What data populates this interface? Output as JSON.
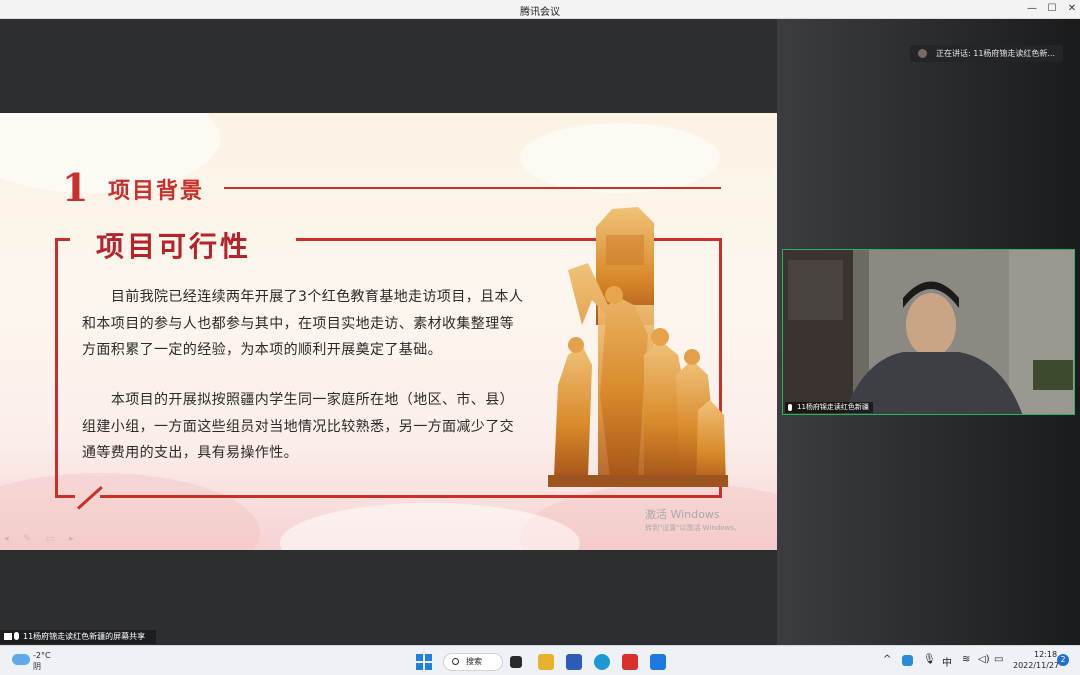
{
  "window": {
    "title": "腾讯会议",
    "minimize": "—",
    "maximize": "☐",
    "close": "✕"
  },
  "slide": {
    "section_number": "1",
    "section_title": "项目背景",
    "subtitle": "项目可行性",
    "paragraph1": "目前我院已经连续两年开展了3个红色教育基地走访项目，且本人和本项目的参与人也都参与其中，在项目实地走访、素材收集整理等方面积累了一定的经验，为本项的顺利开展奠定了基础。",
    "paragraph2": "本项目的开展拟按照疆内学生同一家庭所在地（地区、市、县）组建小组，一方面这些组员对当地情况比较熟悉，另一方面减少了交通等费用的支出，具有易操作性。",
    "accent_color": "#c9302c"
  },
  "watermark": {
    "line1": "激活 Windows",
    "line2": "转到\"设置\"以激活 Windows。"
  },
  "share_bar": {
    "text": "11杨府锦走读红色新疆的屏幕共享"
  },
  "speaking": {
    "text": "正在讲话: 11杨府锦走读红色新..."
  },
  "video": {
    "name": "11杨府锦走读红色新疆"
  },
  "taskbar": {
    "weather_temp": "-2°C",
    "weather_desc": "阴",
    "search_label": "搜索",
    "ime": "中",
    "time": "12:18",
    "date": "2022/11/27",
    "notification_count": "2"
  }
}
